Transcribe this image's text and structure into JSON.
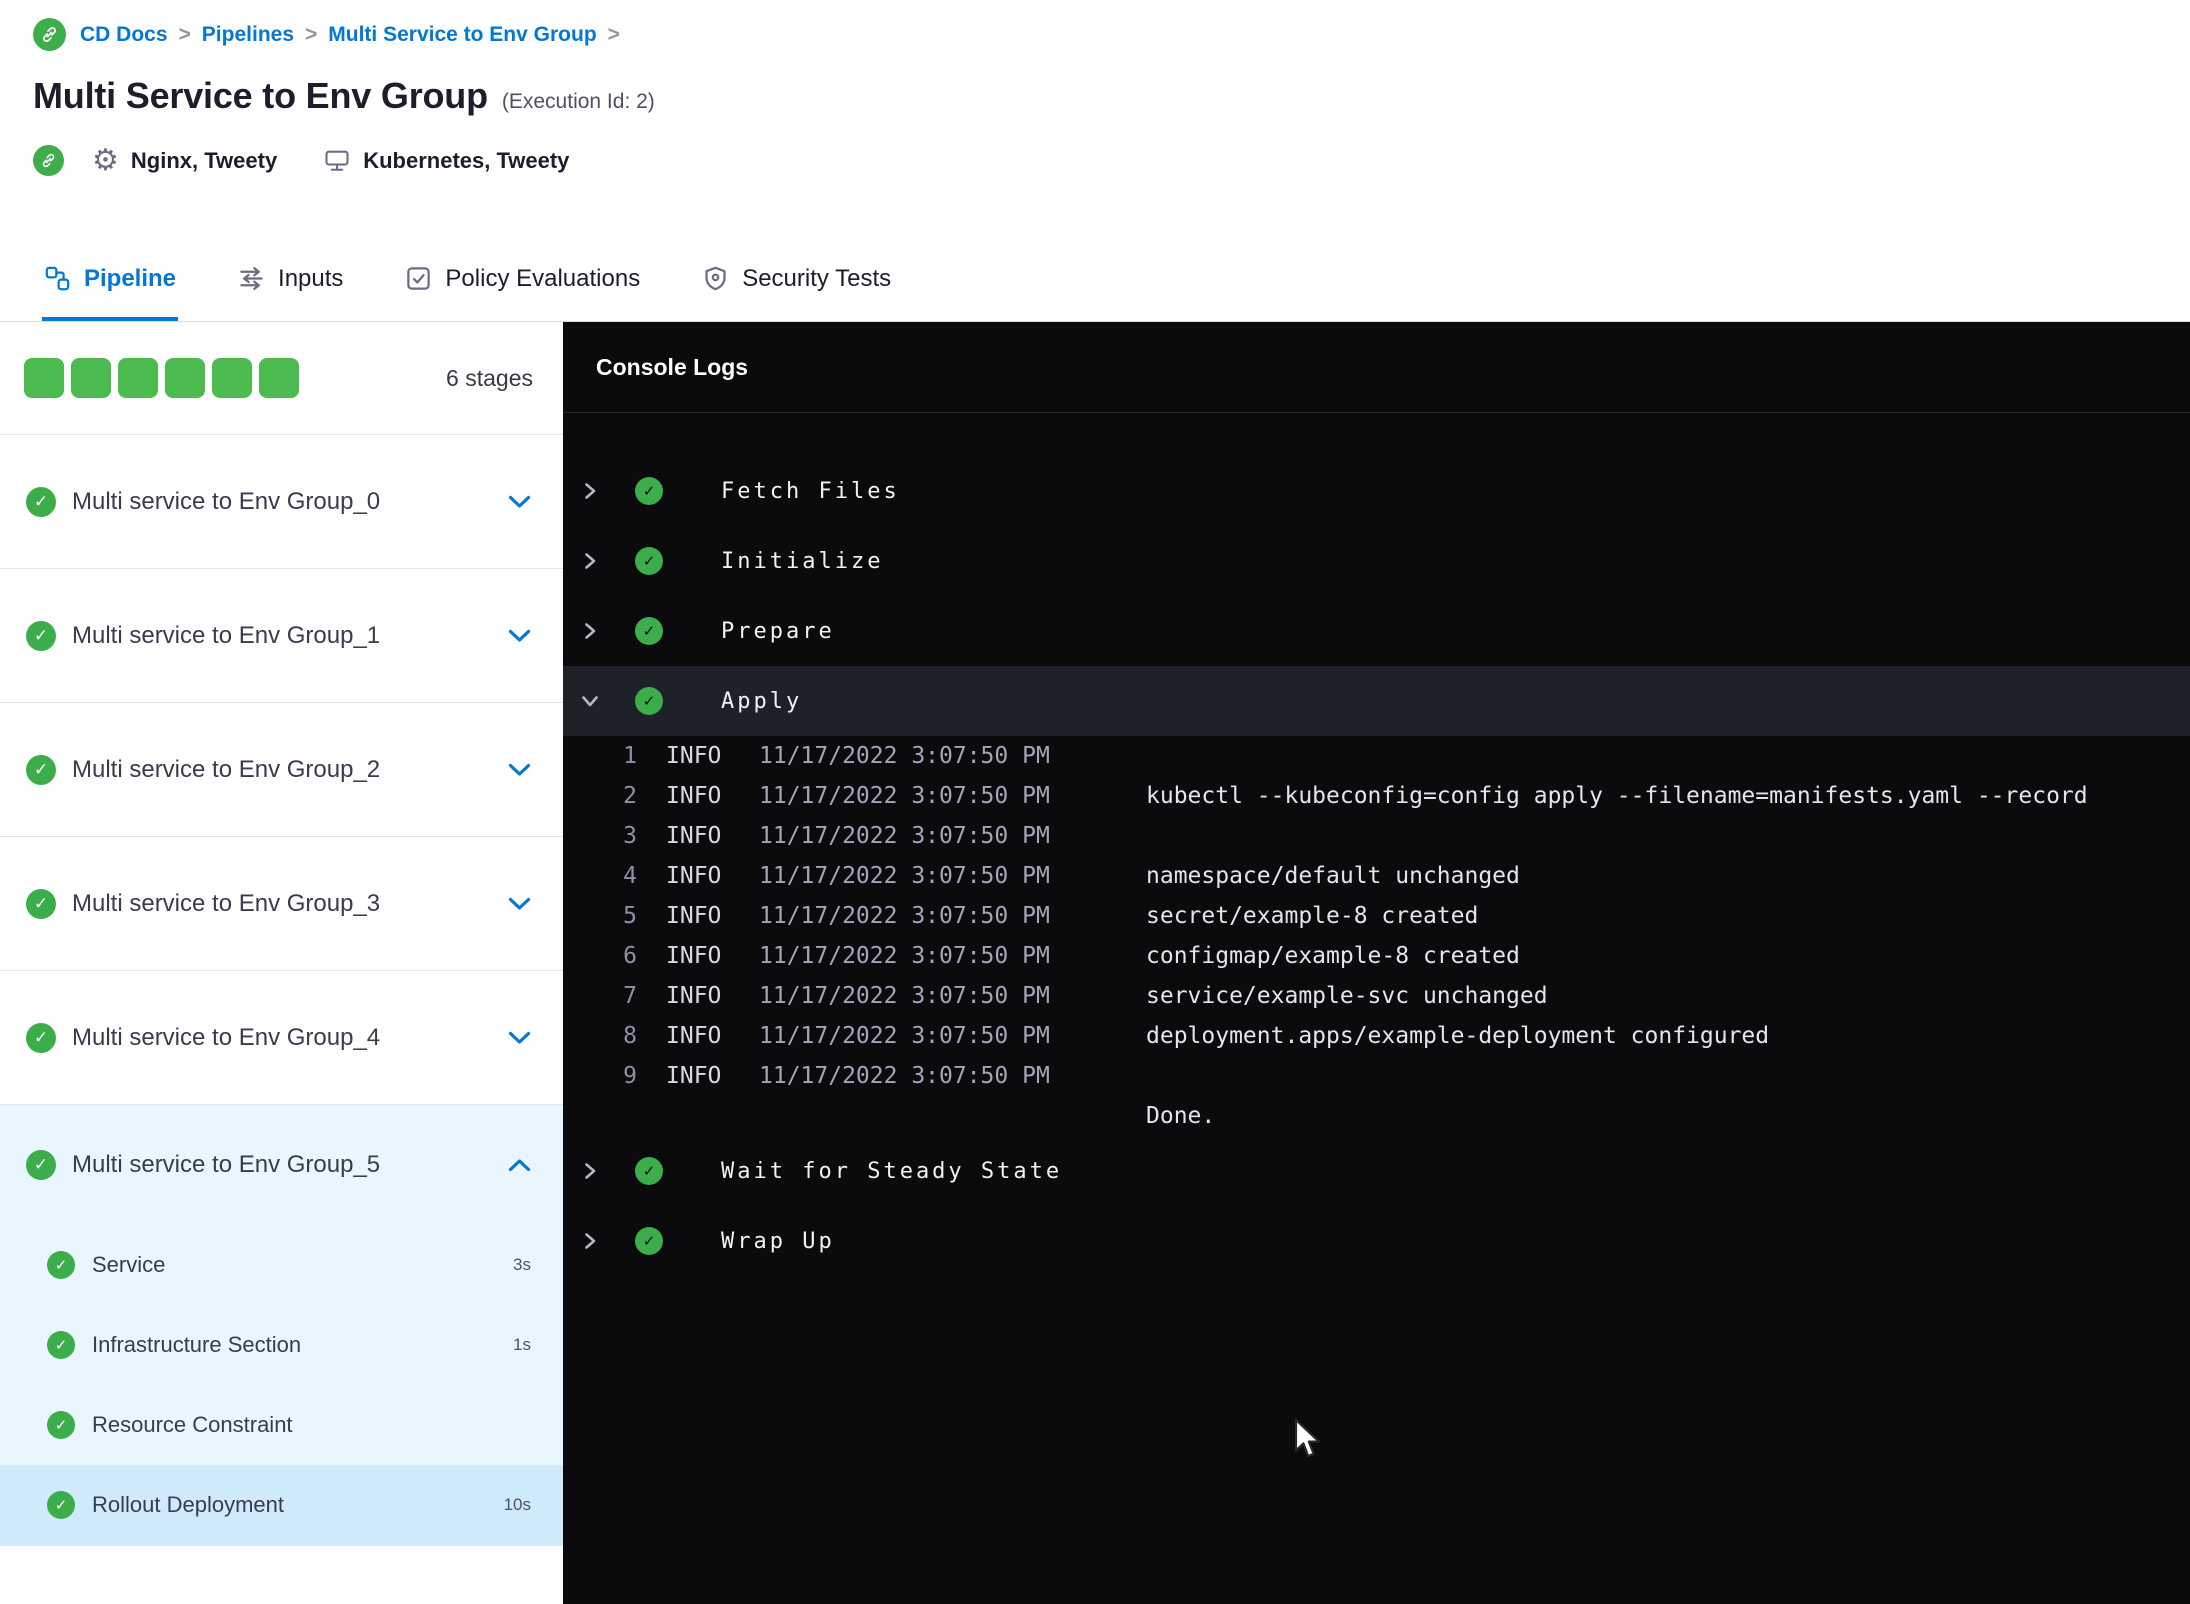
{
  "icons": {
    "gear": "⚙",
    "check": "✓"
  },
  "colors": {
    "primary_blue": "#0278d5",
    "success_green": "#3bae4b",
    "progress_green": "#4cbb4f",
    "console_bg": "#0b0b0e",
    "expanded_stage_bg": "#e9f6fd",
    "selected_step_bg": "#cfeafa"
  },
  "breadcrumb": {
    "separator": ">",
    "items": [
      {
        "label": "CD Docs"
      },
      {
        "label": "Pipelines"
      },
      {
        "label": "Multi Service to Env Group"
      }
    ]
  },
  "header": {
    "title": "Multi Service to Env Group",
    "execution_id": "(Execution Id: 2)",
    "services": "Nginx, Tweety",
    "environments": "Kubernetes, Tweety"
  },
  "tabs": [
    {
      "label": "Pipeline",
      "active": true
    },
    {
      "label": "Inputs",
      "active": false
    },
    {
      "label": "Policy Evaluations",
      "active": false
    },
    {
      "label": "Security Tests",
      "active": false
    }
  ],
  "sidebar": {
    "stages_count": "6 stages",
    "stages": [
      {
        "label": "Multi service to Env Group_0",
        "expanded": false
      },
      {
        "label": "Multi service to Env Group_1",
        "expanded": false
      },
      {
        "label": "Multi service to Env Group_2",
        "expanded": false
      },
      {
        "label": "Multi service to Env Group_3",
        "expanded": false
      },
      {
        "label": "Multi service to Env Group_4",
        "expanded": false
      },
      {
        "label": "Multi service to Env Group_5",
        "expanded": true
      }
    ],
    "steps": [
      {
        "label": "Service",
        "duration": "3s",
        "selected": false
      },
      {
        "label": "Infrastructure Section",
        "duration": "1s",
        "selected": false
      },
      {
        "label": "Resource Constraint",
        "duration": "",
        "selected": false
      },
      {
        "label": "Rollout Deployment",
        "duration": "10s",
        "selected": true
      }
    ]
  },
  "console": {
    "title": "Console Logs",
    "steps": [
      {
        "label": "Fetch Files",
        "expanded": false
      },
      {
        "label": "Initialize",
        "expanded": false
      },
      {
        "label": "Prepare",
        "expanded": false
      },
      {
        "label": "Apply",
        "expanded": true
      },
      {
        "label": "Wait for Steady State",
        "expanded": false
      },
      {
        "label": "Wrap Up",
        "expanded": false
      }
    ],
    "logs": [
      {
        "n": "1",
        "level": "INFO",
        "time": "11/17/2022 3:07:50 PM",
        "msg": ""
      },
      {
        "n": "2",
        "level": "INFO",
        "time": "11/17/2022 3:07:50 PM",
        "msg": "kubectl --kubeconfig=config apply --filename=manifests.yaml --record"
      },
      {
        "n": "3",
        "level": "INFO",
        "time": "11/17/2022 3:07:50 PM",
        "msg": ""
      },
      {
        "n": "4",
        "level": "INFO",
        "time": "11/17/2022 3:07:50 PM",
        "msg": "namespace/default unchanged"
      },
      {
        "n": "5",
        "level": "INFO",
        "time": "11/17/2022 3:07:50 PM",
        "msg": "secret/example-8 created"
      },
      {
        "n": "6",
        "level": "INFO",
        "time": "11/17/2022 3:07:50 PM",
        "msg": "configmap/example-8 created"
      },
      {
        "n": "7",
        "level": "INFO",
        "time": "11/17/2022 3:07:50 PM",
        "msg": "service/example-svc unchanged"
      },
      {
        "n": "8",
        "level": "INFO",
        "time": "11/17/2022 3:07:50 PM",
        "msg": "deployment.apps/example-deployment configured"
      },
      {
        "n": "9",
        "level": "INFO",
        "time": "11/17/2022 3:07:50 PM",
        "msg": ""
      },
      {
        "n": "",
        "level": "",
        "time": "",
        "msg": "Done."
      }
    ]
  }
}
